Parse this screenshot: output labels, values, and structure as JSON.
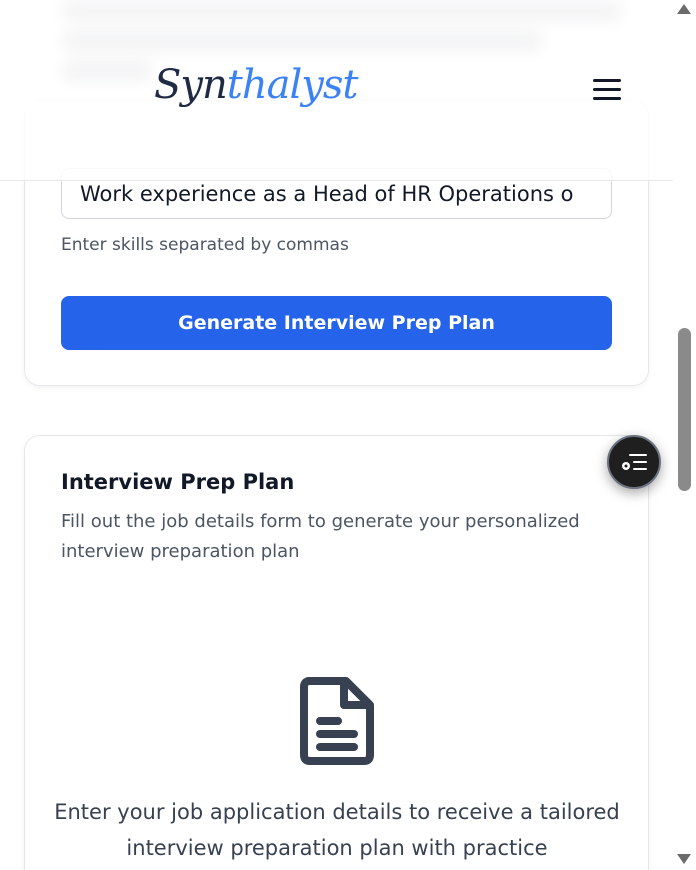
{
  "header": {
    "logo_part1": "Syn",
    "logo_part2": "thalyst",
    "menu_icon": "hamburger-menu-icon"
  },
  "job_form": {
    "skills_value": "Work experience as a Head of HR Operations o",
    "skills_hint": "Enter skills separated by commas",
    "generate_button": "Generate Interview Prep Plan"
  },
  "prep_plan": {
    "title": "Interview Prep Plan",
    "description": "Fill out the job details form to generate your personalized interview preparation plan",
    "empty_icon": "document-icon",
    "empty_message": "Enter your job application details to receive a tailored interview preparation plan with practice"
  },
  "floating_button": {
    "icon": "list-icon"
  },
  "colors": {
    "primary": "#2563eb",
    "logo_dark": "#1f2a44",
    "logo_accent": "#3b82f6",
    "text_muted": "#4b5563"
  }
}
